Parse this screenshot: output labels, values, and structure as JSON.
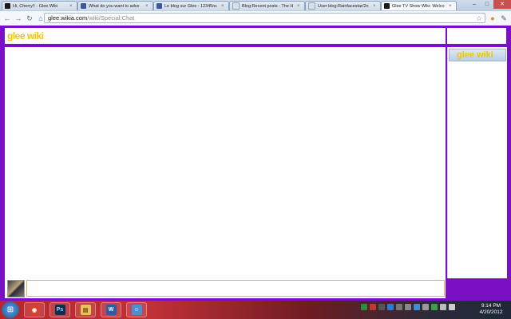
{
  "browser": {
    "tabs": [
      {
        "title": "Hi, Cherry!! - Glee Wiki",
        "favicon_color": "#1a1a1a"
      },
      {
        "title": "What do you want to adve",
        "favicon_color": "#3b5998"
      },
      {
        "title": "Le blog sur Glee : 12345nc",
        "favicon_color": "#3b5998"
      },
      {
        "title": "Blog:Recent posts - The H",
        "favicon_color": "#d7e0ea"
      },
      {
        "title": "User blog:Rainfacestar/2n",
        "favicon_color": "#d7e0ea"
      },
      {
        "title": "Glee TV Show Wiki: Welco",
        "favicon_color": "#1a1a1a",
        "active": true
      }
    ],
    "close_glyph": "×",
    "window_controls": {
      "minimize": "–",
      "maximize": "□",
      "close": "✕"
    },
    "nav": {
      "back": "←",
      "forward": "→",
      "reload": "↻",
      "home": "⌂"
    },
    "url_host": "glee.wikia.com",
    "url_path": "/wiki/Special:Chat",
    "star_glyph": "☆"
  },
  "page": {
    "logo_text": "glee wiki",
    "userlist_logo_text": "glee wiki",
    "chat_input_value": "",
    "colors": {
      "frame": "#7a10c4",
      "logo": "#f5c400",
      "input_border": "#e0b45a"
    }
  },
  "taskbar": {
    "start_glyph": "⊞",
    "pinned": [
      {
        "name": "chrome",
        "glyph": "◉",
        "color": "#d6412f"
      },
      {
        "name": "photoshop",
        "glyph": "Ps",
        "color": "#0b2f52"
      },
      {
        "name": "explorer",
        "glyph": "▤",
        "color": "#e9c35a"
      },
      {
        "name": "word",
        "glyph": "W",
        "color": "#2b5ca8"
      },
      {
        "name": "messenger",
        "glyph": "☺",
        "color": "#4c8ed1"
      }
    ],
    "clock_time": "9:14 PM",
    "clock_date": "4/20/2012"
  }
}
